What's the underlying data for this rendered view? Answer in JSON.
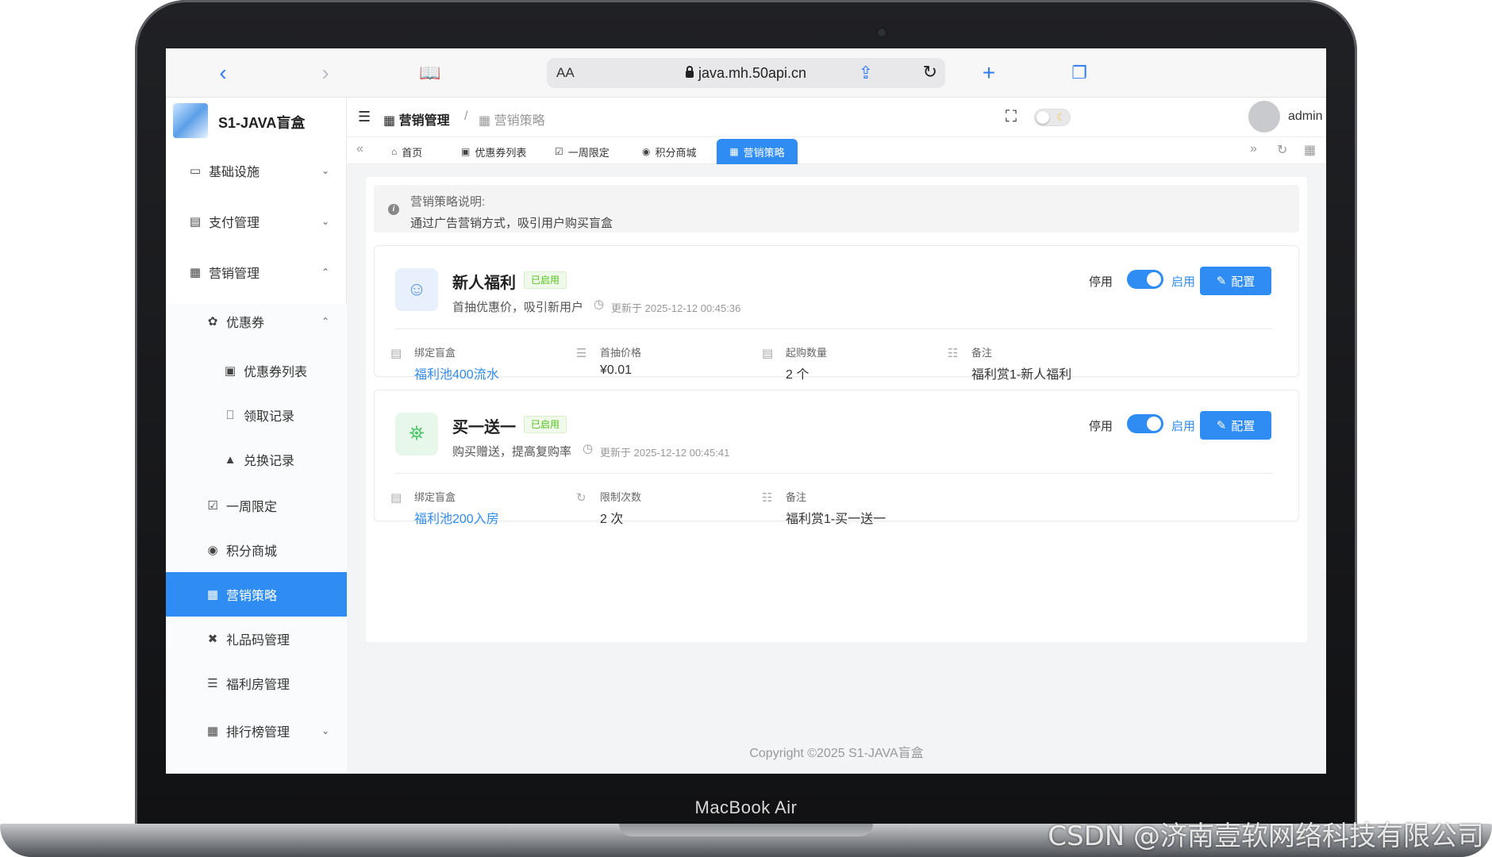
{
  "device": {
    "label": "MacBook Air",
    "watermark": "CSDN @济南壹软网络科技有限公司"
  },
  "browser": {
    "aa_label": "AA",
    "url": "java.mh.50api.cn"
  },
  "app": {
    "title": "S1-JAVA盲盒",
    "admin_name": "admin",
    "copyright": "Copyright ©2025 S1-JAVA盲盒"
  },
  "breadcrumb": {
    "parent": "营销管理",
    "separator": "/",
    "current": "营销策略"
  },
  "sidebar": {
    "items": [
      {
        "label": "基础设施"
      },
      {
        "label": "支付管理"
      },
      {
        "label": "营销管理"
      },
      {
        "label": "优惠券"
      },
      {
        "label": "优惠券列表"
      },
      {
        "label": "领取记录"
      },
      {
        "label": "兑换记录"
      },
      {
        "label": "一周限定"
      },
      {
        "label": "积分商城"
      },
      {
        "label": "营销策略"
      },
      {
        "label": "礼品码管理"
      },
      {
        "label": "福利房管理"
      },
      {
        "label": "排行榜管理"
      }
    ]
  },
  "tabs": [
    {
      "label": "首页"
    },
    {
      "label": "优惠券列表"
    },
    {
      "label": "一周限定"
    },
    {
      "label": "积分商城"
    },
    {
      "label": "营销策略"
    }
  ],
  "notice": {
    "title": "营销策略说明:",
    "description": "通过广告营销方式，吸引用户购买盲盒"
  },
  "strategies": [
    {
      "name": "新人福利",
      "status": "已启用",
      "description": "首抽优惠价，吸引新用户",
      "updated": "更新于 2025-12-12 00:45:36",
      "off_label": "停用",
      "on_label": "启用",
      "enabled": true,
      "config_label": "配置",
      "fields": [
        {
          "label": "绑定盲盒",
          "value": "福利池400流水"
        },
        {
          "label": "首抽价格",
          "value": "¥0.01"
        },
        {
          "label": "起购数量",
          "value": "2 个"
        },
        {
          "label": "备注",
          "value": "福利赏1-新人福利"
        }
      ]
    },
    {
      "name": "买一送一",
      "status": "已启用",
      "description": "购买赠送，提高复购率",
      "updated": "更新于 2025-12-12 00:45:41",
      "off_label": "停用",
      "on_label": "启用",
      "enabled": true,
      "config_label": "配置",
      "fields": [
        {
          "label": "绑定盲盒",
          "value": "福利池200入房"
        },
        {
          "label": "限制次数",
          "value": "2 次"
        },
        {
          "label": "备注",
          "value": "福利赏1-买一送一"
        }
      ]
    }
  ],
  "colors": {
    "accent": "#2f8cf2",
    "success": "#52c41a"
  }
}
